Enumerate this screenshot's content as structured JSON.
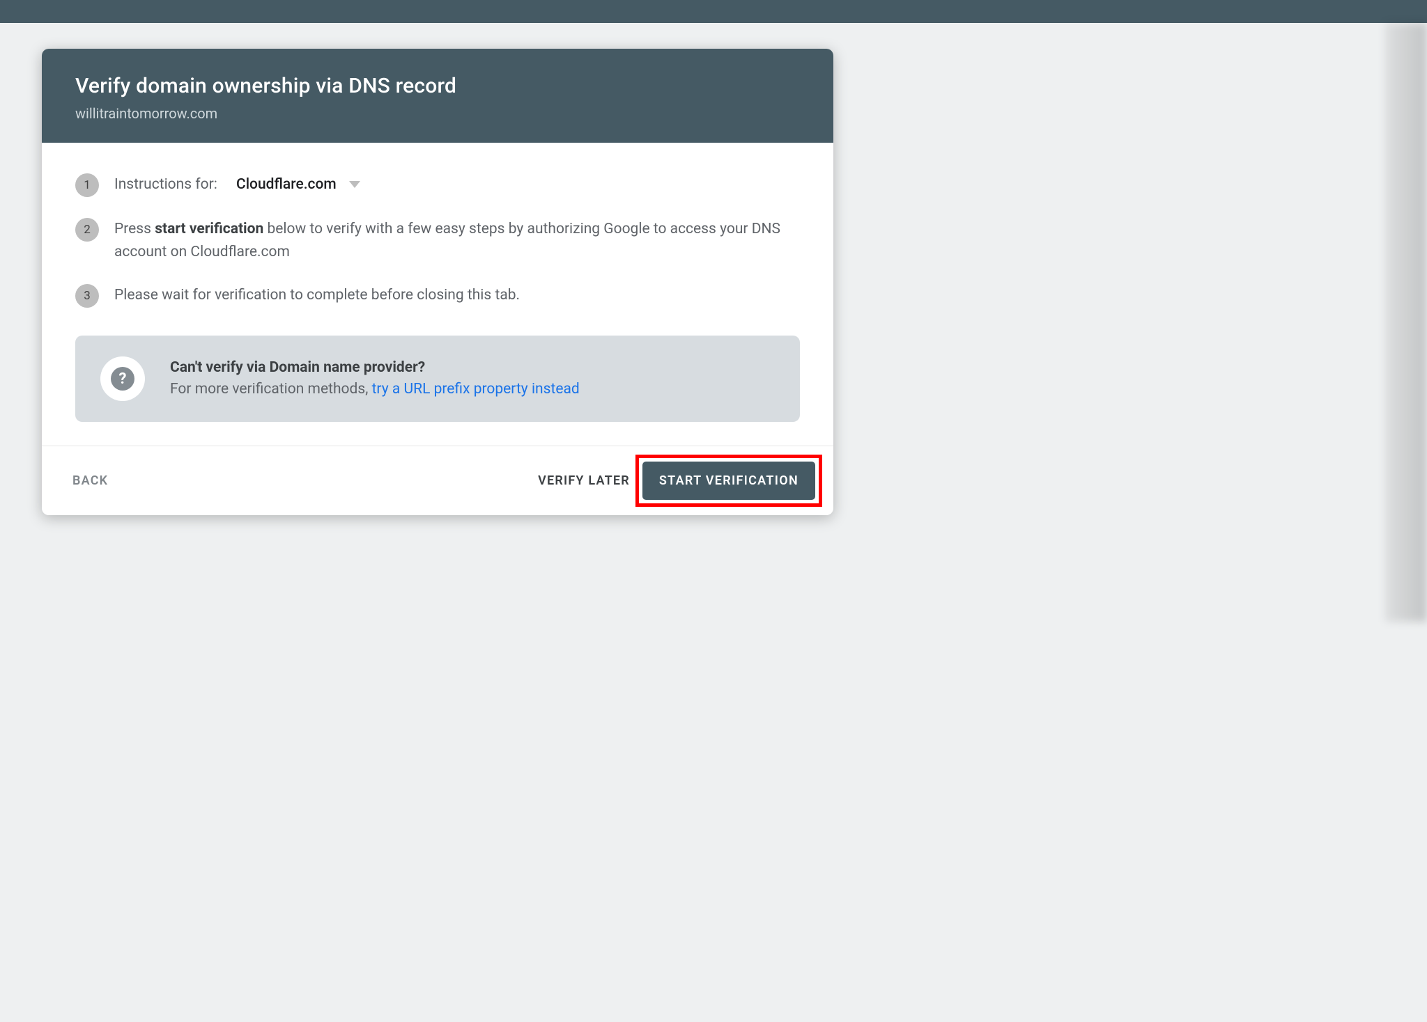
{
  "header": {
    "title": "Verify domain ownership via DNS record",
    "domain": "willitraintomorrow.com"
  },
  "steps": {
    "one": {
      "num": "1",
      "label": "Instructions for:",
      "provider": "Cloudflare.com"
    },
    "two": {
      "num": "2",
      "pre": "Press ",
      "bold": "start verification",
      "post": " below to verify with a few easy steps by authorizing Google to access your DNS account on Cloudflare.com"
    },
    "three": {
      "num": "3",
      "text": "Please wait for verification to complete before closing this tab."
    }
  },
  "alt": {
    "help_glyph": "?",
    "heading": "Can't verify via Domain name provider?",
    "sub": "For more verification methods, ",
    "link": "try a URL prefix property instead"
  },
  "footer": {
    "back": "BACK",
    "later": "VERIFY LATER",
    "start": "START VERIFICATION"
  }
}
